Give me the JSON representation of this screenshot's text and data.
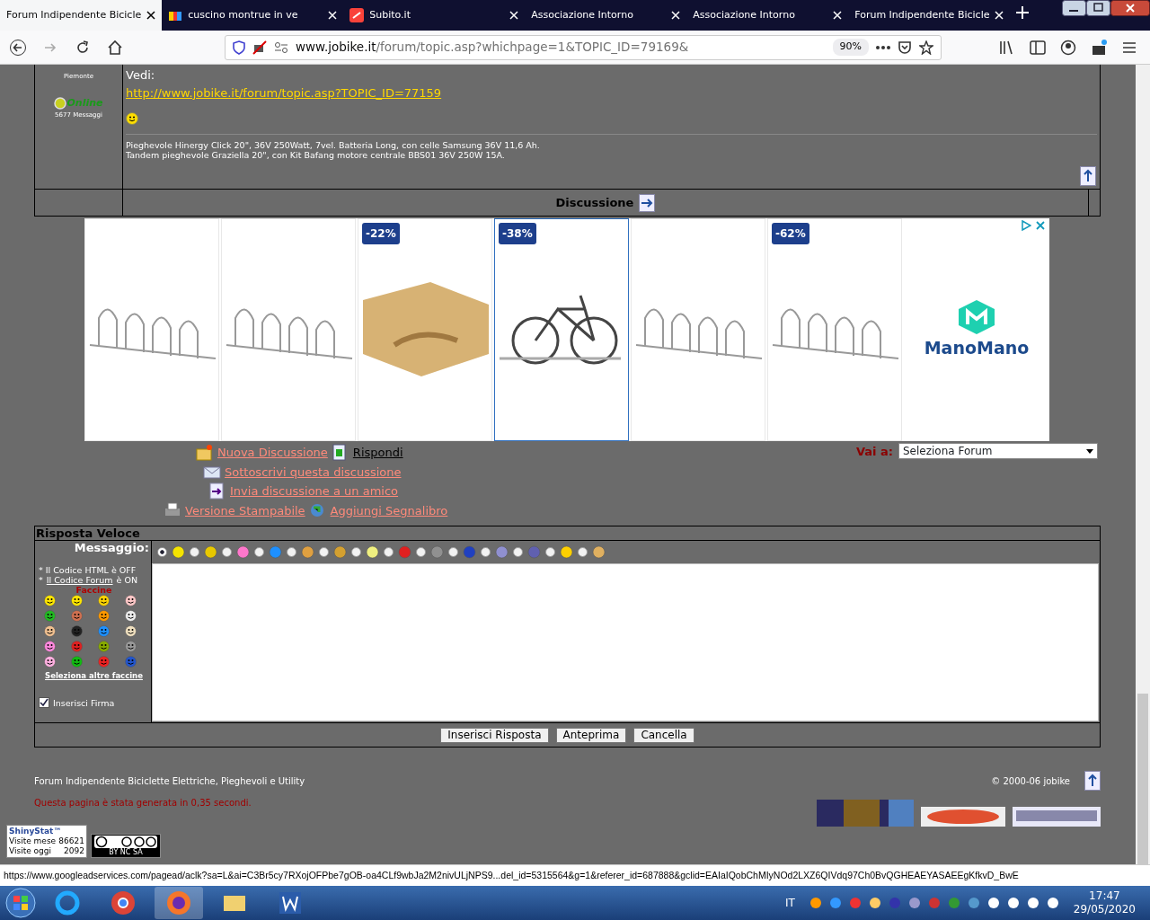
{
  "browser": {
    "tabs": [
      {
        "title": "Forum Indipendente Bicicle",
        "selected": true
      },
      {
        "title": "cuscino montrue in ve",
        "selected": false
      },
      {
        "title": "Subito.it",
        "selected": false
      },
      {
        "title": "Associazione Intorno",
        "selected": false
      },
      {
        "title": "Associazione Intorno",
        "selected": false
      },
      {
        "title": "Forum Indipendente Bicicle",
        "selected": false
      }
    ],
    "url_host": "www.jobike.it",
    "url_path": "/forum/topic.asp?whichpage=1&TOPIC_ID=79169&",
    "zoom": "90%"
  },
  "post": {
    "location": "Piemonte",
    "status": "Online",
    "count": "5677 Messaggi",
    "lines": [
      "Vedi:"
    ],
    "link": "http://www.jobike.it/forum/topic.asp?TOPIC_ID=77159",
    "signature": [
      "Pieghevole Hinergy Click 20\", 36V 250Watt, 7vel. Batteria Long, con celle Samsung 36V 11,6 Ah.",
      "Tandem pieghevole Graziella 20\", con Kit Bafang motore centrale BBS01 36V 250W 15A."
    ]
  },
  "section_title": "Discussione",
  "ad": {
    "tiles": [
      {
        "kind": "rack",
        "highlighted": false
      },
      {
        "kind": "rack",
        "highlighted": false
      },
      {
        "kind": "shelf",
        "discount": "-22%",
        "highlighted": false
      },
      {
        "kind": "bike",
        "discount": "-38%",
        "highlighted": true
      },
      {
        "kind": "rack",
        "highlighted": false
      },
      {
        "kind": "rack",
        "discount": "-62%",
        "highlighted": false
      }
    ],
    "brand": "ManoMano"
  },
  "links": [
    [
      {
        "text": "Nuova Discussione",
        "visited": false
      },
      {
        "text": "Rispondi",
        "visited": true
      }
    ],
    [
      {
        "text": "Sottoscrivi questa discussione",
        "visited": false
      }
    ],
    [
      {
        "text": "Invia discussione a un amico",
        "visited": false
      }
    ],
    [
      {
        "text": "Versione Stampabile",
        "visited": false
      },
      {
        "text": "Aggiungi Segnalibro",
        "visited": false
      }
    ]
  ],
  "jump": {
    "label": "Vai a:",
    "value": "Seleziona Forum"
  },
  "reply": {
    "title": "Risposta Veloce",
    "label": "Messaggio:",
    "message_icons": [
      {
        "selected": true,
        "color": "#f5e400"
      },
      {
        "selected": false,
        "color": "#e8c800"
      },
      {
        "selected": false,
        "color": "#ff77cc"
      },
      {
        "selected": false,
        "color": "#1e90ff"
      },
      {
        "selected": false,
        "color": "#e0a040"
      },
      {
        "selected": false,
        "color": "#d4a030"
      },
      {
        "selected": false,
        "color": "#f0f080"
      },
      {
        "selected": false,
        "color": "#e02020"
      },
      {
        "selected": false,
        "color": "#909090"
      },
      {
        "selected": false,
        "color": "#2040c0"
      },
      {
        "selected": false,
        "color": "#9090d0"
      },
      {
        "selected": false,
        "color": "#6060b0"
      },
      {
        "selected": false,
        "color": "#ffd000"
      },
      {
        "selected": false,
        "color": "#e0b060"
      }
    ],
    "notes": [
      {
        "text": "* Il Codice HTML è OFF"
      },
      {
        "before": "*",
        "link": "Il Codice Forum",
        "after": "è ON"
      }
    ],
    "smilies_title": "Faccine",
    "smilies": [
      {
        "color": "#ffe600"
      },
      {
        "color": "#ffe600"
      },
      {
        "color": "#ffd400"
      },
      {
        "color": "#ffc8c8"
      },
      {
        "color": "#22bb22"
      },
      {
        "color": "#d07050"
      },
      {
        "color": "#ff9900"
      },
      {
        "color": "#eeeeee"
      },
      {
        "color": "#f0c090"
      },
      {
        "color": "#222222"
      },
      {
        "color": "#1e90ff"
      },
      {
        "color": "#f0e0c0"
      },
      {
        "color": "#ff88dd"
      },
      {
        "color": "#e02020"
      },
      {
        "color": "#88aa00"
      },
      {
        "color": "#999999"
      },
      {
        "color": "#ffb0e0"
      },
      {
        "color": "#11bb11"
      },
      {
        "color": "#ee2222"
      },
      {
        "color": "#2255cc"
      }
    ],
    "more_smilies": "Seleziona altre faccine",
    "signature_label": "Inserisci Firma",
    "signature_checked": true,
    "buttons": [
      "Inserisci Risposta",
      "Anteprima",
      "Cancella"
    ]
  },
  "footer": {
    "site": "Forum Indipendente Biciclette Elettriche, Pieghevoli e Utility",
    "copyright": "© 2000-06 jobike",
    "timing": "Questa pagina è stata generata in 0,35 secondi.",
    "stats": {
      "brand": "ShinyStat™",
      "rows": [
        {
          "label": "Visite mese",
          "value": "86621"
        },
        {
          "label": "Visite oggi",
          "value": "2092"
        }
      ]
    },
    "license": "BY NC SA"
  },
  "status_url": "https://www.googleadservices.com/pagead/aclk?sa=L&ai=C3Br5cy7RXojOFPbe7gOB-oa4CLf9wbJa2M2nivULjNPS9...del_id=5315564&g=1&referer_id=687888&gclid=EAIaIQobChMIyNOd2LXZ6QIVdq97Ch0BvQGHEAEYASAEEgKfkvD_BwE",
  "taskbar": {
    "language": "IT",
    "time": "17:47",
    "date": "29/05/2020"
  }
}
